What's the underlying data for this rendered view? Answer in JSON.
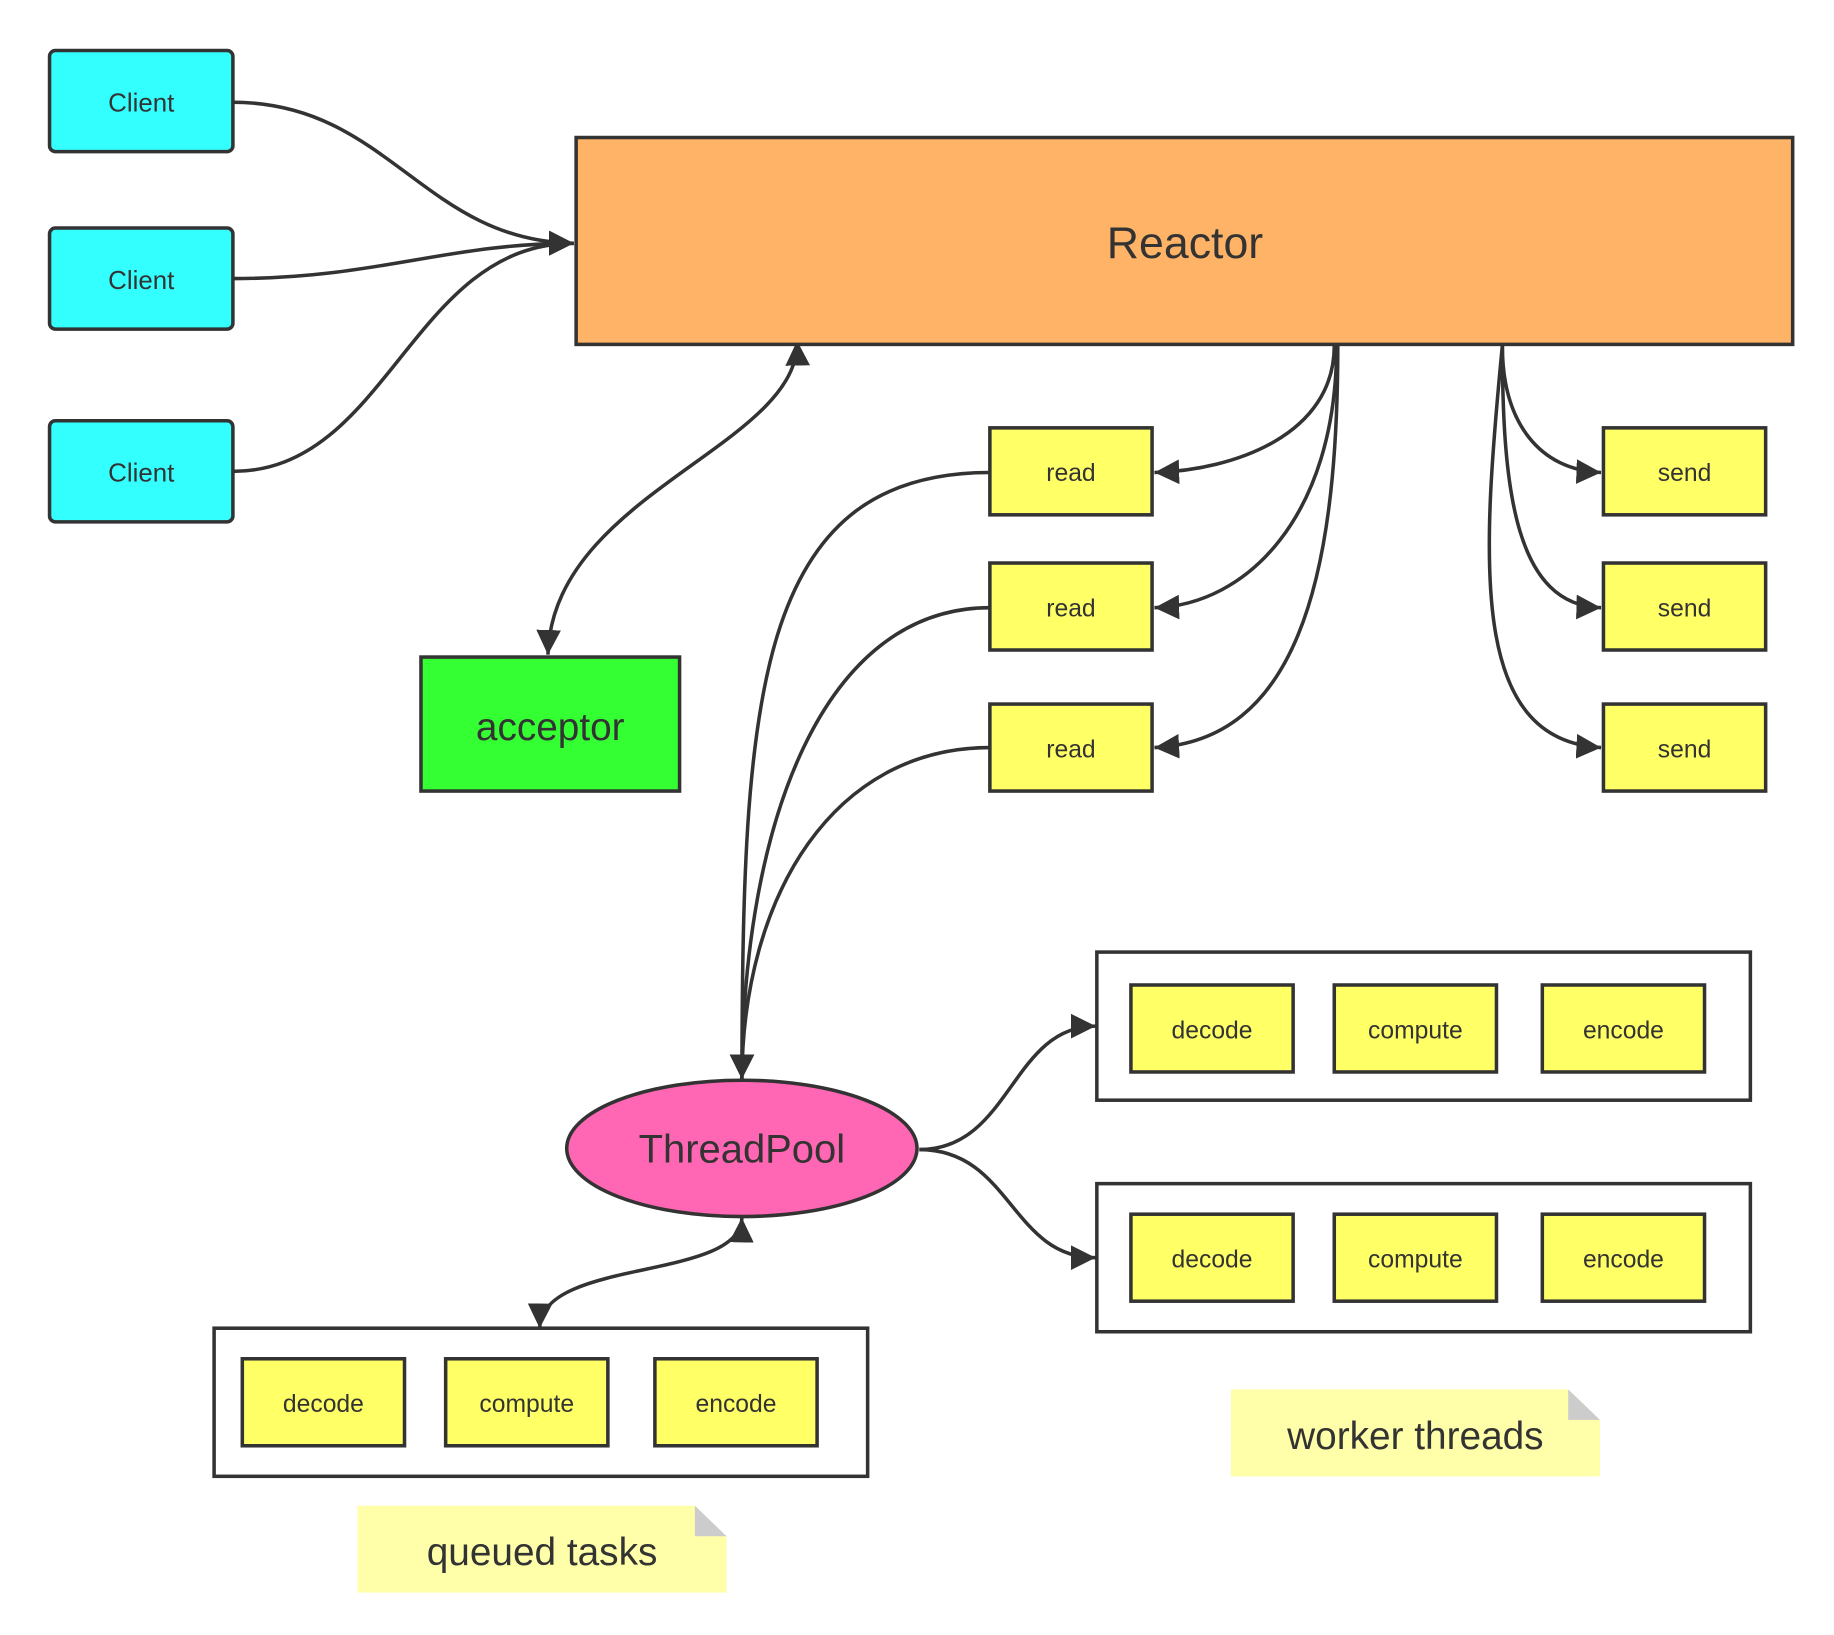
{
  "colors": {
    "client": "#33FFFF",
    "reactor": "#FFB366",
    "acceptor": "#33FF33",
    "task": "#FFFF66",
    "threadpool": "#FF66B3",
    "note": "#FFFFAA",
    "stroke": "#333333"
  },
  "clients": [
    {
      "label": "Client"
    },
    {
      "label": "Client"
    },
    {
      "label": "Client"
    }
  ],
  "reactor": {
    "label": "Reactor"
  },
  "acceptor": {
    "label": "acceptor"
  },
  "reads": [
    {
      "label": "read"
    },
    {
      "label": "read"
    },
    {
      "label": "read"
    }
  ],
  "sends": [
    {
      "label": "send"
    },
    {
      "label": "send"
    },
    {
      "label": "send"
    }
  ],
  "threadpool": {
    "label": "ThreadPool"
  },
  "worker_groups": [
    {
      "tasks": [
        {
          "label": "decode"
        },
        {
          "label": "compute"
        },
        {
          "label": "encode"
        }
      ]
    },
    {
      "tasks": [
        {
          "label": "decode"
        },
        {
          "label": "compute"
        },
        {
          "label": "encode"
        }
      ]
    }
  ],
  "queue_group": {
    "tasks": [
      {
        "label": "decode"
      },
      {
        "label": "compute"
      },
      {
        "label": "encode"
      }
    ]
  },
  "notes": {
    "worker": "worker threads",
    "queued": "queued tasks"
  }
}
